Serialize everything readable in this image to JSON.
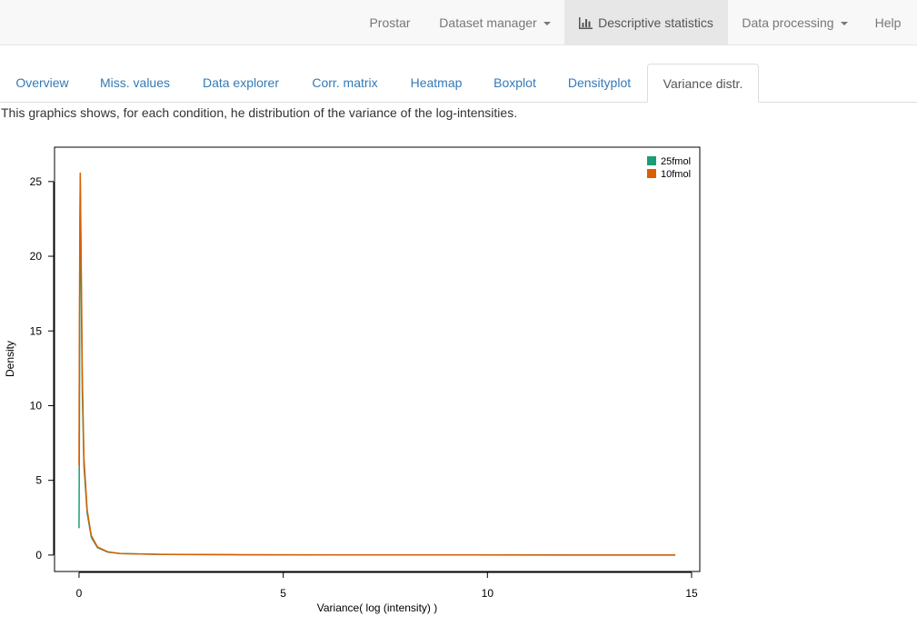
{
  "navbar": {
    "items": [
      {
        "label": "Prostar"
      },
      {
        "label": "Dataset manager"
      },
      {
        "label": "Descriptive statistics"
      },
      {
        "label": "Data processing"
      },
      {
        "label": "Help"
      }
    ]
  },
  "tabs": [
    {
      "label": "Overview"
    },
    {
      "label": "Miss. values"
    },
    {
      "label": "Data explorer"
    },
    {
      "label": "Corr. matrix"
    },
    {
      "label": "Heatmap"
    },
    {
      "label": "Boxplot"
    },
    {
      "label": "Densityplot"
    },
    {
      "label": "Variance distr."
    }
  ],
  "description": "This graphics shows, for each condition, he distribution of the variance of the log-intensities.",
  "colors": {
    "link": "#337ab7",
    "series_25fmol": "#1b9e77",
    "series_10fmol": "#d95f02"
  },
  "chart_data": {
    "type": "line",
    "title": "",
    "xlabel": "Variance( log (intensity) )",
    "ylabel": "Density",
    "xlim": [
      -0.6,
      15.2
    ],
    "ylim": [
      -1.1,
      27.3
    ],
    "x_ticks": [
      "0",
      "5",
      "10",
      "15"
    ],
    "y_ticks": [
      "0",
      "5",
      "10",
      "15",
      "20",
      "25"
    ],
    "grid": false,
    "legend_position": "top-right",
    "series": [
      {
        "name": "25fmol",
        "color": "#1b9e77",
        "points": [
          [
            0.0,
            1.8
          ],
          [
            0.01,
            8.5
          ],
          [
            0.02,
            20.0
          ],
          [
            0.03,
            25.0
          ],
          [
            0.05,
            19.0
          ],
          [
            0.08,
            11.0
          ],
          [
            0.12,
            6.0
          ],
          [
            0.2,
            2.8
          ],
          [
            0.3,
            1.2
          ],
          [
            0.45,
            0.5
          ],
          [
            0.7,
            0.2
          ],
          [
            1.0,
            0.1
          ],
          [
            2.0,
            0.04
          ],
          [
            4.0,
            0.02
          ],
          [
            8.0,
            0.01
          ],
          [
            12.0,
            0.005
          ],
          [
            14.6,
            0.0
          ]
        ]
      },
      {
        "name": "10fmol",
        "color": "#d95f02",
        "points": [
          [
            0.0,
            6.0
          ],
          [
            0.01,
            16.0
          ],
          [
            0.02,
            22.0
          ],
          [
            0.03,
            25.6
          ],
          [
            0.05,
            20.5
          ],
          [
            0.08,
            12.0
          ],
          [
            0.12,
            6.5
          ],
          [
            0.2,
            3.0
          ],
          [
            0.3,
            1.3
          ],
          [
            0.45,
            0.55
          ],
          [
            0.7,
            0.22
          ],
          [
            1.0,
            0.1
          ],
          [
            2.0,
            0.05
          ],
          [
            4.0,
            0.02
          ],
          [
            8.0,
            0.01
          ],
          [
            12.0,
            0.005
          ],
          [
            14.6,
            0.0
          ]
        ]
      }
    ]
  }
}
